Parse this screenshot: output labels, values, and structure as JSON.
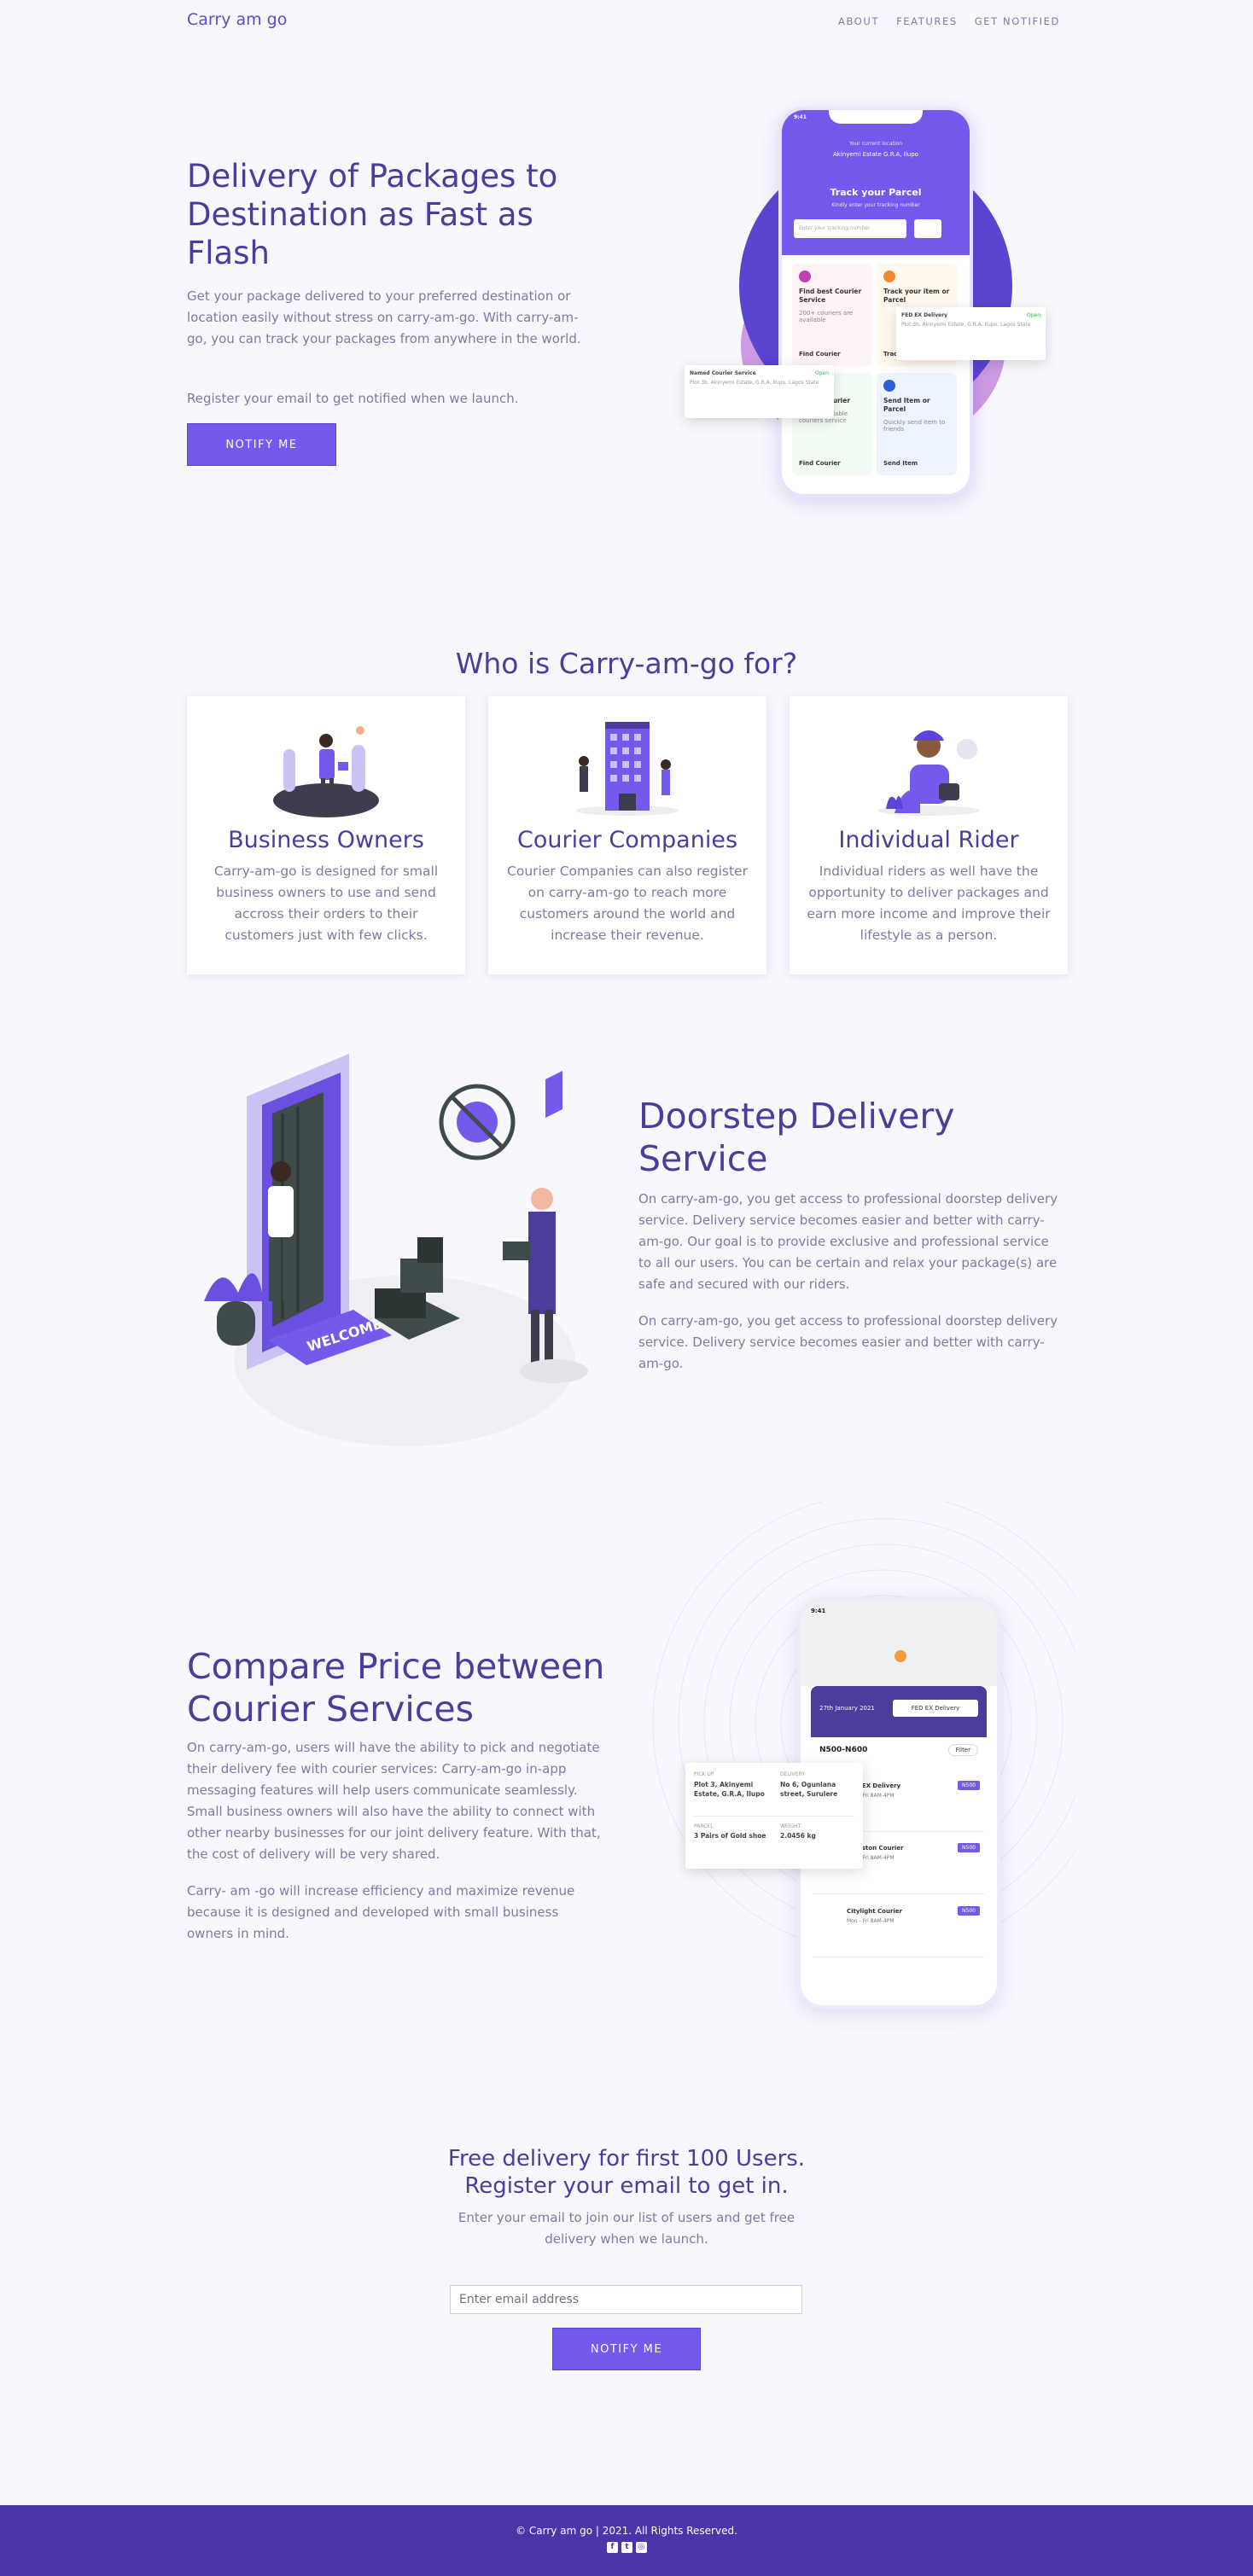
{
  "brand": {
    "logo": "Carry am go"
  },
  "nav": {
    "items": [
      "ABOUT",
      "FEATURES",
      "GET NOTIFIED"
    ]
  },
  "hero": {
    "title": "Delivery of Packages to Destination as Fast as Flash",
    "text": "Get your package delivered to your preferred destination or location easily without stress on carry-am-go. With carry-am-go, you can track your packages from anywhere in the world.",
    "sub": "Register your email to get notified when we launch.",
    "button": "NOTIFY ME"
  },
  "phone1": {
    "time": "9:41",
    "location_label": "Your current location",
    "location": "Akinyemi Estate G.R.A, Ilupo",
    "title": "Track your Parcel",
    "subtitle": "Kindly enter your tracking number",
    "input_placeholder": "Enter your tracking number",
    "tiles": [
      {
        "title": "Find best Courier Service",
        "desc": "200+ couriers are available",
        "action": "Find Courier"
      },
      {
        "title": "Track your item or Parcel",
        "desc": "",
        "action": "Track"
      },
      {
        "title": "Cheap Courier",
        "desc": "200+ affordable couriers service",
        "action": "Find Courier"
      },
      {
        "title": "Send Item or Parcel",
        "desc": "Quickly send item to friends",
        "action": "Send Item"
      }
    ],
    "card_a": {
      "name": "FED EX Delivery",
      "status": "Open",
      "address": "Plot 3b, Akinyemi Estate, G.R.A, Ilupo, Lagos State"
    },
    "card_b": {
      "name": "Named Courier Service",
      "status": "Open",
      "address": "Plot 3b, Akinyemi Estate, G.R.A, Ilupo, Lagos State"
    }
  },
  "who": {
    "title": "Who is Carry-am-go for?",
    "cards": [
      {
        "title": "Business Owners",
        "text": "Carry-am-go is designed for small business owners to use and send accross their orders to their customers just with few clicks."
      },
      {
        "title": "Courier Companies",
        "text": "Courier Companies can also register on carry-am-go to reach more customers around the world and increase their revenue."
      },
      {
        "title": "Individual Rider",
        "text": "Individual riders as well have the opportunity to deliver packages and earn more income and improve their lifestyle as a person."
      }
    ]
  },
  "doorstep": {
    "title": "Doorstep Delivery Service",
    "p1": "On carry-am-go, you get access to professional doorstep delivery service. Delivery service becomes easier and better with carry-am-go. Our goal is to provide exclusive and professional service to all our users. You can be certain and relax your package(s) are safe and secured with our riders.",
    "p2": "On carry-am-go, you get access to professional doorstep delivery service. Delivery service becomes easier and better with carry-am-go.",
    "door_sign": "WELCOME"
  },
  "compare": {
    "title": "Compare Price between Courier Services",
    "p1": "On carry-am-go, users will have the ability to pick and negotiate their delivery fee with courier services: Carry-am-go in-app messaging features will help users communicate seamlessly. Small business owners will also have the ability to connect with other nearby businesses for our joint delivery feature. With that, the cost of delivery will be very shared.",
    "p2": "Carry- am -go will increase efficiency and maximize revenue because it is designed and developed with small business owners in mind.",
    "phone": {
      "time": "9:41",
      "date": "27th January 2021",
      "service": "FED EX Delivery",
      "range": "N500-N600",
      "filter": "Filter",
      "items": [
        {
          "name": "FED EX Delivery",
          "price": "N500",
          "hours": "Mon - Fri 8AM-4PM"
        },
        {
          "name": "Kingston Courier",
          "price": "N500",
          "hours": "Mon - Fri 8AM-4PM"
        },
        {
          "name": "Citylight Courier",
          "price": "N500",
          "hours": "Mon - Fri 8AM-4PM"
        }
      ]
    },
    "detail": {
      "pickup_label": "PICK UP",
      "pickup": "Plot 3, Akinyemi Estate, G.R.A, Ilupo",
      "delivery_label": "DELIVERY",
      "delivery": "No 6, Ogunlana street, Surulere",
      "parcel_label": "PARCEL",
      "parcel": "3 Pairs of Gold shoe",
      "weight_label": "WEIGHT",
      "weight": "2.0456 kg"
    }
  },
  "signup": {
    "title_line1": "Free delivery for first 100 Users.",
    "title_line2": "Register your email to get in.",
    "sub": "Enter your email to join our list of users and get free delivery when we launch.",
    "placeholder": "Enter email address",
    "button": "NOTIFY ME"
  },
  "footer": {
    "copyright": "© Carry am go | 2021. All Rights Reserved.",
    "socials": [
      "facebook-icon",
      "twitter-icon",
      "instagram-icon"
    ]
  },
  "colors": {
    "primary": "#7559ec",
    "heading": "#4a3d9c",
    "footer": "#4c35a9",
    "bg": "#f7f7fd"
  }
}
